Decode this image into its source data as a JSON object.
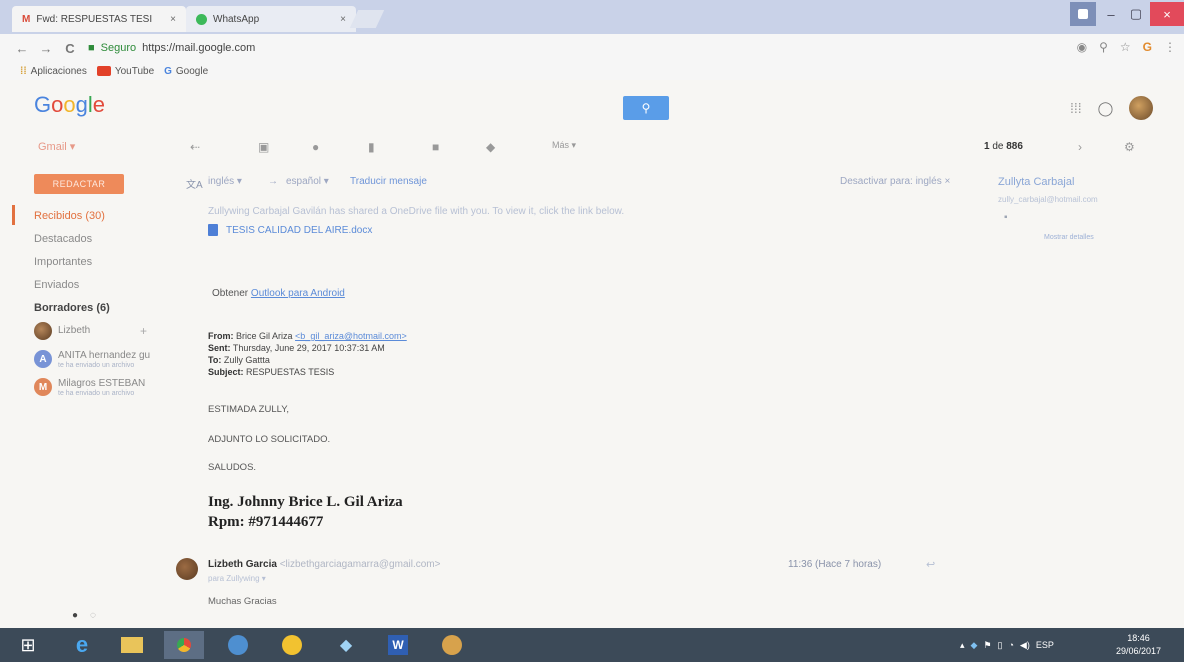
{
  "browser": {
    "tabs": [
      {
        "label": "Fwd: RESPUESTAS TESI",
        "close": "×"
      },
      {
        "label": "WhatsApp",
        "close": "×"
      }
    ],
    "secure_label": "Seguro",
    "url_prefix": "https://mail.google.com",
    "nav": {
      "back": "←",
      "forward": "→",
      "reload": "C"
    },
    "bookmarks": [
      "Aplicaciones",
      "YouTube",
      "Google"
    ],
    "window_controls": {
      "minimize": "–",
      "maximize": "▢",
      "close": "×"
    }
  },
  "gmail": {
    "logo": "Google",
    "mail_dropdown": "Gmail ▾",
    "more_label": "Más ▾",
    "pager": {
      "page": "1",
      "of_label": "de",
      "total": "886"
    },
    "compose_label": "REDACTAR",
    "nav_items": [
      {
        "label": "Recibidos (30)"
      },
      {
        "label": "Destacados"
      },
      {
        "label": "Importantes"
      },
      {
        "label": "Enviados"
      },
      {
        "label": "Borradores (6)"
      }
    ],
    "contacts": [
      {
        "name": "Lizbeth",
        "initial": "",
        "sub": ""
      },
      {
        "name": "ANITA hernandez gu",
        "initial": "A",
        "sub": "te ha enviado un archivo"
      },
      {
        "name": "Milagros ESTEBAN",
        "initial": "M",
        "sub": "te ha enviado un archivo"
      }
    ],
    "translate": {
      "from": "inglés ▾",
      "arrow": "→",
      "to": "español ▾",
      "action": "Traducir mensaje",
      "disable": "Desactivar para: inglés ×"
    },
    "email": {
      "shared_line": "Zullywing Carbajal Gavilán has shared a OneDrive file with you. To view it, click the link below.",
      "doc_name": "TESIS CALIDAD DEL AIRE.docx",
      "outlook_prefix": "Obtener",
      "outlook_link": "Outlook para Android",
      "headers": {
        "from_label": "From:",
        "from_name": "Brice Gil Ariza",
        "from_email": "<b_gil_ariza@hotmail.com>",
        "sent_label": "Sent:",
        "sent_value": "Thursday, June 29, 2017 10:37:31 AM",
        "to_label": "To:",
        "to_value": "Zully Gattta",
        "subject_label": "Subject:",
        "subject_value": "RESPUESTAS TESIS"
      },
      "body": [
        "ESTIMADA ZULLY,",
        "ADJUNTO LO SOLICITADO.",
        "SALUDOS."
      ],
      "signature": [
        "Ing. Johnny Brice L. Gil Ariza",
        "Rpm: #971444677"
      ]
    },
    "reply": {
      "from_name": "Lizbeth Garcia",
      "from_email": "<lizbethgarciagamarra@gmail.com>",
      "to_line": "para Zullywing ▾",
      "time": "11:36 (Hace 7 horas)",
      "body": "Muchas Gracias"
    },
    "sender_panel": {
      "name": "Zullyta Carbajal",
      "email": "zully_carbajal@hotmail.com",
      "more": "Mostrar detalles"
    }
  },
  "taskbar": {
    "language": "ESP",
    "time": "18:46",
    "date": "29/06/2017"
  },
  "colors": {
    "compose": "#ee8a5a",
    "search": "#5a9de8",
    "active_nav": "#e2713f",
    "link": "#5b8bd8",
    "taskbar": "#3c4a58",
    "close_button": "#e24a5b"
  }
}
